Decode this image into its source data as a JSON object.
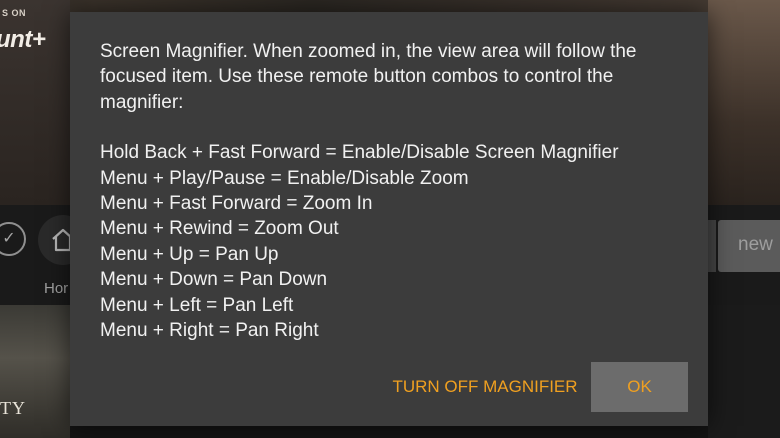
{
  "background": {
    "brand_small": "S ON",
    "brand_big": "unt+",
    "nav_check_icon": "check-circle-icon",
    "nav_home_icon": "home-icon",
    "nav_home_label": "Hor",
    "right_tile_label": "new",
    "poster_text": "TY"
  },
  "dialog": {
    "intro": "Screen Magnifier. When zoomed in, the view area will follow the focused item. Use these remote button combos to control the magnifier:",
    "combos": [
      "Hold Back + Fast Forward = Enable/Disable Screen Magnifier",
      "Menu + Play/Pause = Enable/Disable Zoom",
      "Menu + Fast Forward = Zoom In",
      "Menu + Rewind = Zoom Out",
      "Menu + Up = Pan Up",
      "Menu + Down = Pan Down",
      "Menu + Left = Pan Left",
      "Menu + Right = Pan Right"
    ],
    "turn_off_label": "TURN OFF MAGNIFIER",
    "ok_label": "OK"
  },
  "colors": {
    "dialog_bg": "#3c3c3c",
    "accent": "#f0a020",
    "ok_button_bg": "#6c6c6c",
    "text": "#f1f1f1"
  }
}
